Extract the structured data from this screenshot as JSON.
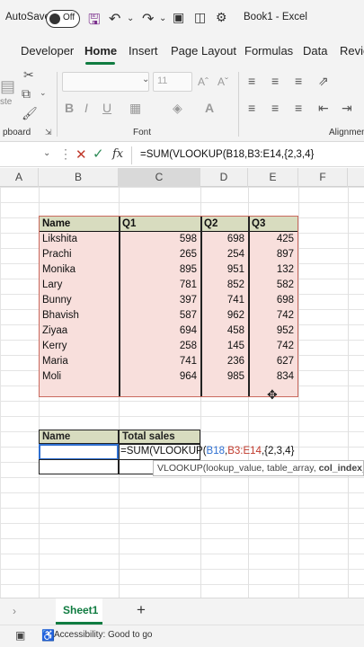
{
  "titlebar": {
    "autosave_label": "AutoSave",
    "toggle_state": "Off",
    "title": "Book1 - Excel"
  },
  "tabs": [
    "Developer",
    "Home",
    "Insert",
    "Page Layout",
    "Formulas",
    "Data",
    "Revie"
  ],
  "ribbon": {
    "font_size": "11",
    "groups": {
      "clipboard": "pboard",
      "font": "Font",
      "alignment": "Alignmen"
    },
    "paste_label": "ste"
  },
  "formula_bar": {
    "fx": "fx",
    "formula": "=SUM(VLOOKUP(B18,B3:E14,{2,3,4}"
  },
  "columns": [
    "A",
    "B",
    "C",
    "D",
    "E",
    "F"
  ],
  "table": {
    "headers": [
      "Name",
      "Q1",
      "Q2",
      "Q3"
    ],
    "rows": [
      {
        "name": "Likshita",
        "q1": "598",
        "q2": "698",
        "q3": "425"
      },
      {
        "name": "Prachi",
        "q1": "265",
        "q2": "254",
        "q3": "897"
      },
      {
        "name": "Monika",
        "q1": "895",
        "q2": "951",
        "q3": "132"
      },
      {
        "name": "Lary",
        "q1": "781",
        "q2": "852",
        "q3": "582"
      },
      {
        "name": "Bunny",
        "q1": "397",
        "q2": "741",
        "q3": "698"
      },
      {
        "name": "Bhavish",
        "q1": "587",
        "q2": "962",
        "q3": "742"
      },
      {
        "name": "Ziyaa",
        "q1": "694",
        "q2": "458",
        "q3": "952"
      },
      {
        "name": "Kerry",
        "q1": "258",
        "q2": "145",
        "q3": "742"
      },
      {
        "name": "Maria",
        "q1": "741",
        "q2": "236",
        "q3": "627"
      },
      {
        "name": "Moli",
        "q1": "964",
        "q2": "985",
        "q3": "834"
      }
    ]
  },
  "result": {
    "headers": [
      "Name",
      "Total sales"
    ],
    "edit_prefix": "=SUM(VLOOKUP(",
    "edit_b18": "B18",
    "edit_comma": ",",
    "edit_range": "B3:E14",
    "edit_suffix": ",{2,3,4}",
    "tooltip_plain": "VLOOKUP(lookup_value, table_array, ",
    "tooltip_bold": "col_index_nu"
  },
  "sheets": [
    "Sheet1"
  ],
  "status": {
    "accessibility": "Accessibility: Good to go"
  },
  "colors": {
    "excel_green": "#107c41",
    "table_fill": "#f8dfdc",
    "header_fill": "#d8dcbf",
    "selection_blue": "#2e6fd1"
  }
}
